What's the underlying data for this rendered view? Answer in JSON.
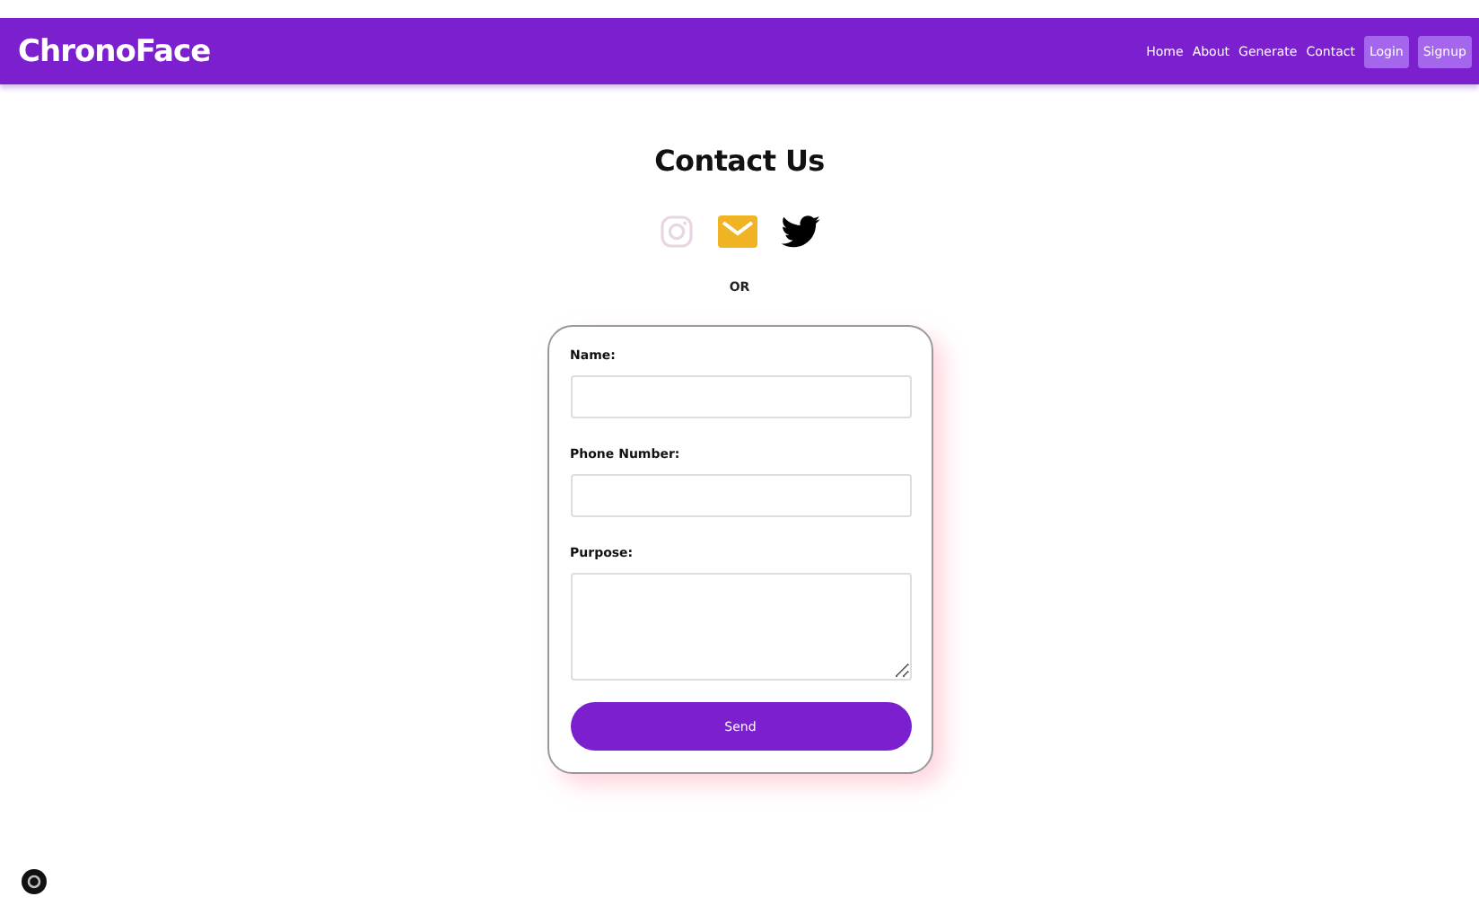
{
  "navbar": {
    "brand": "ChronoFace",
    "links": [
      {
        "label": "Home",
        "kind": "link"
      },
      {
        "label": "About",
        "kind": "link"
      },
      {
        "label": "Generate",
        "kind": "link"
      },
      {
        "label": "Contact",
        "kind": "link"
      },
      {
        "label": "Login",
        "kind": "button"
      },
      {
        "label": "Signup",
        "kind": "button"
      }
    ]
  },
  "heading": "Contact Us",
  "social": [
    {
      "kind": "instagram"
    },
    {
      "kind": "mail"
    },
    {
      "kind": "twitter"
    }
  ],
  "separator": "OR",
  "form": {
    "fields": [
      {
        "label": "Name:",
        "kind": "input"
      },
      {
        "label": "Phone Number:",
        "kind": "input"
      },
      {
        "label": "Purpose:",
        "kind": "textarea"
      }
    ],
    "submit": "Send"
  }
}
